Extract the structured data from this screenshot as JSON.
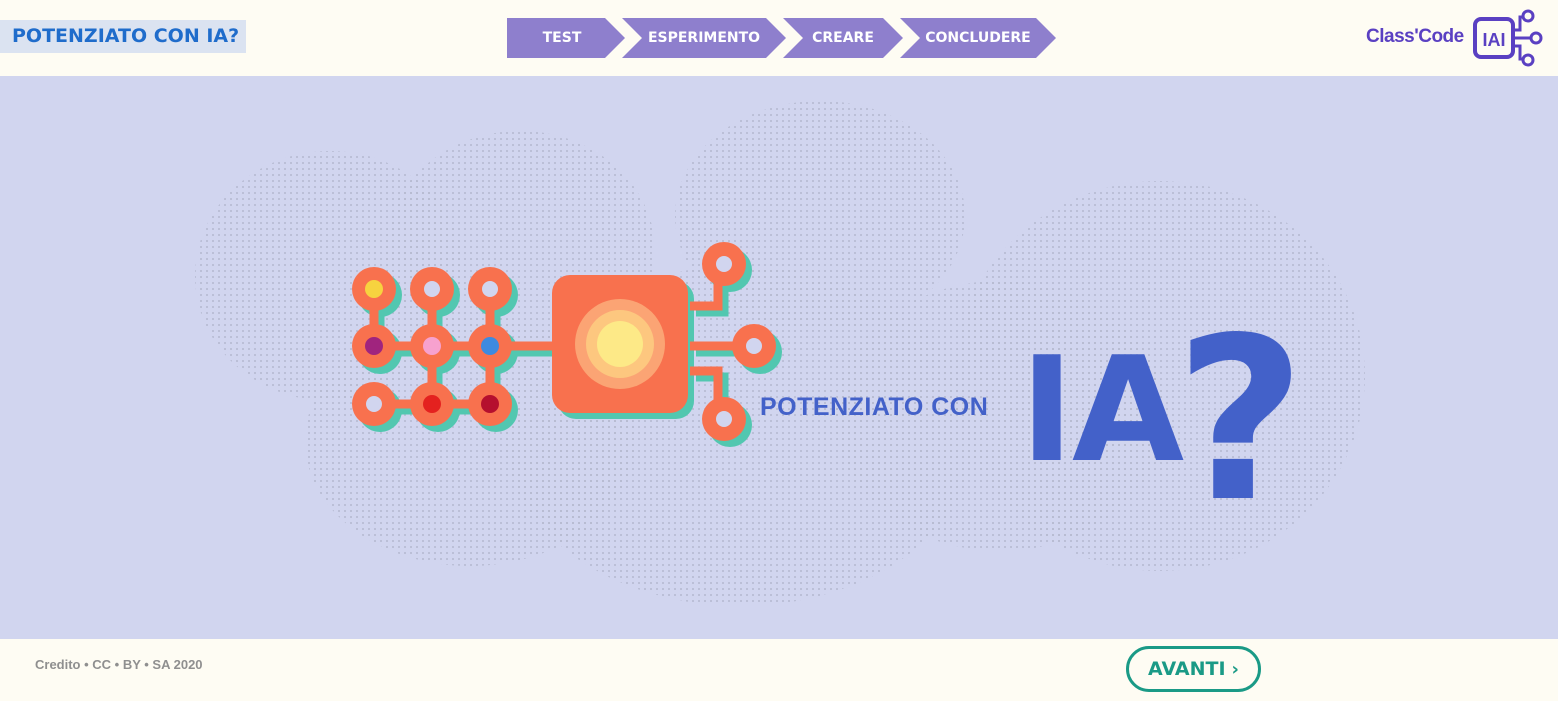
{
  "header": {
    "page_title": "POTENZIATO CON IA?",
    "steps": [
      {
        "label": "TEST"
      },
      {
        "label": "ESPERIMENTO"
      },
      {
        "label": "CREARE"
      },
      {
        "label": "CONCLUDERE"
      }
    ],
    "brand": {
      "name": "Class'Code",
      "badge": "IAI"
    }
  },
  "hero": {
    "subtitle": "POTENZIATO CON",
    "headline": "IA",
    "question_mark": "?",
    "icon": "circuit-chip-illustration"
  },
  "footer": {
    "credit": "Credito • CC • BY • SA 2020",
    "next_label": "AVANTI",
    "next_icon": "chevron-right-icon"
  },
  "colors": {
    "accent_purple": "#8e7fcd",
    "brand_purple": "#5a40c2",
    "title_blue": "#1f6ccb",
    "hero_blue": "#4361c9",
    "circuit_orange": "#f8714e",
    "circuit_teal": "#52c7b0",
    "button_green": "#1a9a86",
    "background_lavender": "#d1d5ef"
  }
}
